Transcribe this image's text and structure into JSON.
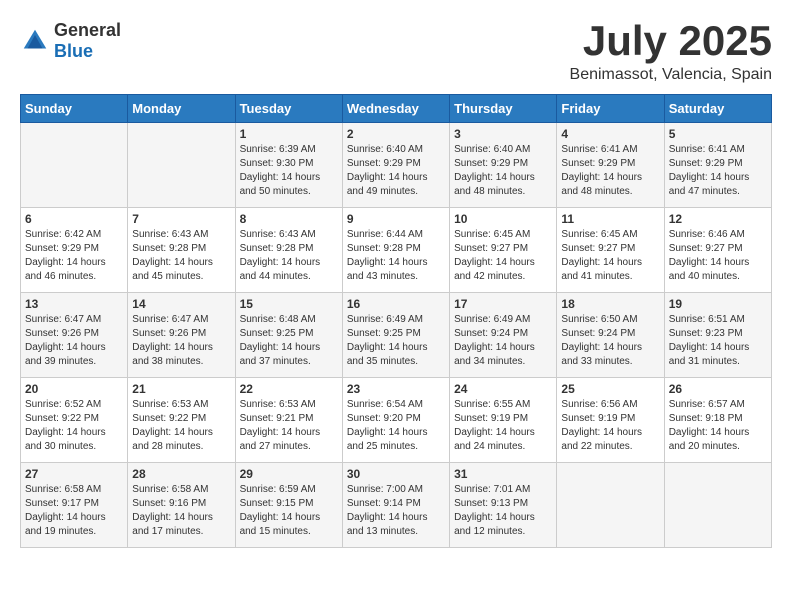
{
  "header": {
    "logo_general": "General",
    "logo_blue": "Blue",
    "month": "July 2025",
    "location": "Benimassot, Valencia, Spain"
  },
  "weekdays": [
    "Sunday",
    "Monday",
    "Tuesday",
    "Wednesday",
    "Thursday",
    "Friday",
    "Saturday"
  ],
  "weeks": [
    [
      {
        "day": "",
        "sunrise": "",
        "sunset": "",
        "daylight": ""
      },
      {
        "day": "",
        "sunrise": "",
        "sunset": "",
        "daylight": ""
      },
      {
        "day": "1",
        "sunrise": "Sunrise: 6:39 AM",
        "sunset": "Sunset: 9:30 PM",
        "daylight": "Daylight: 14 hours and 50 minutes."
      },
      {
        "day": "2",
        "sunrise": "Sunrise: 6:40 AM",
        "sunset": "Sunset: 9:29 PM",
        "daylight": "Daylight: 14 hours and 49 minutes."
      },
      {
        "day": "3",
        "sunrise": "Sunrise: 6:40 AM",
        "sunset": "Sunset: 9:29 PM",
        "daylight": "Daylight: 14 hours and 48 minutes."
      },
      {
        "day": "4",
        "sunrise": "Sunrise: 6:41 AM",
        "sunset": "Sunset: 9:29 PM",
        "daylight": "Daylight: 14 hours and 48 minutes."
      },
      {
        "day": "5",
        "sunrise": "Sunrise: 6:41 AM",
        "sunset": "Sunset: 9:29 PM",
        "daylight": "Daylight: 14 hours and 47 minutes."
      }
    ],
    [
      {
        "day": "6",
        "sunrise": "Sunrise: 6:42 AM",
        "sunset": "Sunset: 9:29 PM",
        "daylight": "Daylight: 14 hours and 46 minutes."
      },
      {
        "day": "7",
        "sunrise": "Sunrise: 6:43 AM",
        "sunset": "Sunset: 9:28 PM",
        "daylight": "Daylight: 14 hours and 45 minutes."
      },
      {
        "day": "8",
        "sunrise": "Sunrise: 6:43 AM",
        "sunset": "Sunset: 9:28 PM",
        "daylight": "Daylight: 14 hours and 44 minutes."
      },
      {
        "day": "9",
        "sunrise": "Sunrise: 6:44 AM",
        "sunset": "Sunset: 9:28 PM",
        "daylight": "Daylight: 14 hours and 43 minutes."
      },
      {
        "day": "10",
        "sunrise": "Sunrise: 6:45 AM",
        "sunset": "Sunset: 9:27 PM",
        "daylight": "Daylight: 14 hours and 42 minutes."
      },
      {
        "day": "11",
        "sunrise": "Sunrise: 6:45 AM",
        "sunset": "Sunset: 9:27 PM",
        "daylight": "Daylight: 14 hours and 41 minutes."
      },
      {
        "day": "12",
        "sunrise": "Sunrise: 6:46 AM",
        "sunset": "Sunset: 9:27 PM",
        "daylight": "Daylight: 14 hours and 40 minutes."
      }
    ],
    [
      {
        "day": "13",
        "sunrise": "Sunrise: 6:47 AM",
        "sunset": "Sunset: 9:26 PM",
        "daylight": "Daylight: 14 hours and 39 minutes."
      },
      {
        "day": "14",
        "sunrise": "Sunrise: 6:47 AM",
        "sunset": "Sunset: 9:26 PM",
        "daylight": "Daylight: 14 hours and 38 minutes."
      },
      {
        "day": "15",
        "sunrise": "Sunrise: 6:48 AM",
        "sunset": "Sunset: 9:25 PM",
        "daylight": "Daylight: 14 hours and 37 minutes."
      },
      {
        "day": "16",
        "sunrise": "Sunrise: 6:49 AM",
        "sunset": "Sunset: 9:25 PM",
        "daylight": "Daylight: 14 hours and 35 minutes."
      },
      {
        "day": "17",
        "sunrise": "Sunrise: 6:49 AM",
        "sunset": "Sunset: 9:24 PM",
        "daylight": "Daylight: 14 hours and 34 minutes."
      },
      {
        "day": "18",
        "sunrise": "Sunrise: 6:50 AM",
        "sunset": "Sunset: 9:24 PM",
        "daylight": "Daylight: 14 hours and 33 minutes."
      },
      {
        "day": "19",
        "sunrise": "Sunrise: 6:51 AM",
        "sunset": "Sunset: 9:23 PM",
        "daylight": "Daylight: 14 hours and 31 minutes."
      }
    ],
    [
      {
        "day": "20",
        "sunrise": "Sunrise: 6:52 AM",
        "sunset": "Sunset: 9:22 PM",
        "daylight": "Daylight: 14 hours and 30 minutes."
      },
      {
        "day": "21",
        "sunrise": "Sunrise: 6:53 AM",
        "sunset": "Sunset: 9:22 PM",
        "daylight": "Daylight: 14 hours and 28 minutes."
      },
      {
        "day": "22",
        "sunrise": "Sunrise: 6:53 AM",
        "sunset": "Sunset: 9:21 PM",
        "daylight": "Daylight: 14 hours and 27 minutes."
      },
      {
        "day": "23",
        "sunrise": "Sunrise: 6:54 AM",
        "sunset": "Sunset: 9:20 PM",
        "daylight": "Daylight: 14 hours and 25 minutes."
      },
      {
        "day": "24",
        "sunrise": "Sunrise: 6:55 AM",
        "sunset": "Sunset: 9:19 PM",
        "daylight": "Daylight: 14 hours and 24 minutes."
      },
      {
        "day": "25",
        "sunrise": "Sunrise: 6:56 AM",
        "sunset": "Sunset: 9:19 PM",
        "daylight": "Daylight: 14 hours and 22 minutes."
      },
      {
        "day": "26",
        "sunrise": "Sunrise: 6:57 AM",
        "sunset": "Sunset: 9:18 PM",
        "daylight": "Daylight: 14 hours and 20 minutes."
      }
    ],
    [
      {
        "day": "27",
        "sunrise": "Sunrise: 6:58 AM",
        "sunset": "Sunset: 9:17 PM",
        "daylight": "Daylight: 14 hours and 19 minutes."
      },
      {
        "day": "28",
        "sunrise": "Sunrise: 6:58 AM",
        "sunset": "Sunset: 9:16 PM",
        "daylight": "Daylight: 14 hours and 17 minutes."
      },
      {
        "day": "29",
        "sunrise": "Sunrise: 6:59 AM",
        "sunset": "Sunset: 9:15 PM",
        "daylight": "Daylight: 14 hours and 15 minutes."
      },
      {
        "day": "30",
        "sunrise": "Sunrise: 7:00 AM",
        "sunset": "Sunset: 9:14 PM",
        "daylight": "Daylight: 14 hours and 13 minutes."
      },
      {
        "day": "31",
        "sunrise": "Sunrise: 7:01 AM",
        "sunset": "Sunset: 9:13 PM",
        "daylight": "Daylight: 14 hours and 12 minutes."
      },
      {
        "day": "",
        "sunrise": "",
        "sunset": "",
        "daylight": ""
      },
      {
        "day": "",
        "sunrise": "",
        "sunset": "",
        "daylight": ""
      }
    ]
  ]
}
